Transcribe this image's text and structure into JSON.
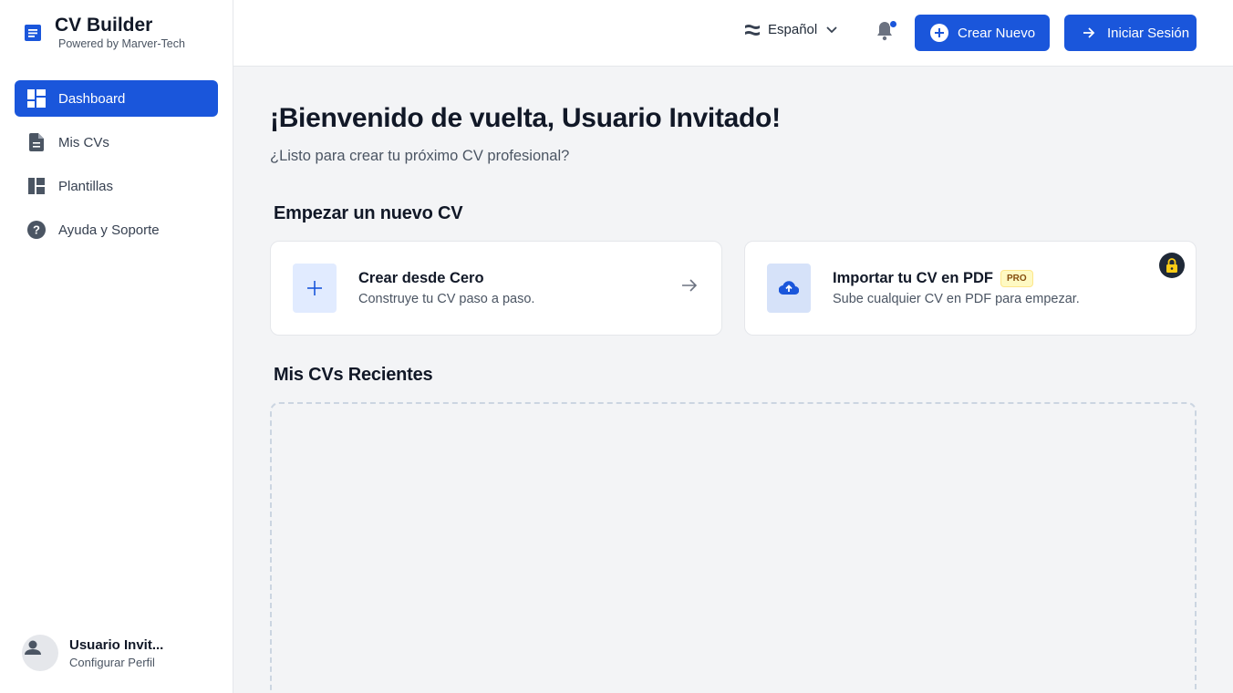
{
  "app": {
    "title": "CV Builder",
    "subtitle": "Powered by Marver-Tech",
    "accent_color": "#1a56db"
  },
  "sidebar": {
    "items": [
      {
        "label": "Dashboard",
        "icon": "dashboard-grid-icon",
        "active": true
      },
      {
        "label": "Mis CVs",
        "icon": "document-icon",
        "active": false
      },
      {
        "label": "Plantillas",
        "icon": "layout-template-icon",
        "active": false
      },
      {
        "label": "Ayuda y Soporte",
        "icon": "help-circle-icon",
        "active": false
      }
    ],
    "user": {
      "name": "Usuario Invit...",
      "link": "Configurar Perfil"
    }
  },
  "header": {
    "language": "Español",
    "notifications_icon": "bell-icon",
    "create_label": "Crear Nuevo",
    "login_label": "Iniciar Sesión"
  },
  "main": {
    "welcome": "¡Bienvenido de vuelta, Usuario Invitado!",
    "subtitle": "¿Listo para crear tu próximo CV profesional?",
    "start_section": "Empezar un nuevo CV",
    "cards": [
      {
        "title": "Crear desde Cero",
        "desc": "Construye tu CV paso a paso.",
        "icon": "plus-icon"
      },
      {
        "title": "Importar tu CV en PDF",
        "desc": "Sube cualquier CV en PDF para empezar.",
        "badge": "PRO",
        "icon": "cloud-upload-icon",
        "locked": true
      }
    ],
    "recent_section": "Mis CVs Recientes"
  }
}
